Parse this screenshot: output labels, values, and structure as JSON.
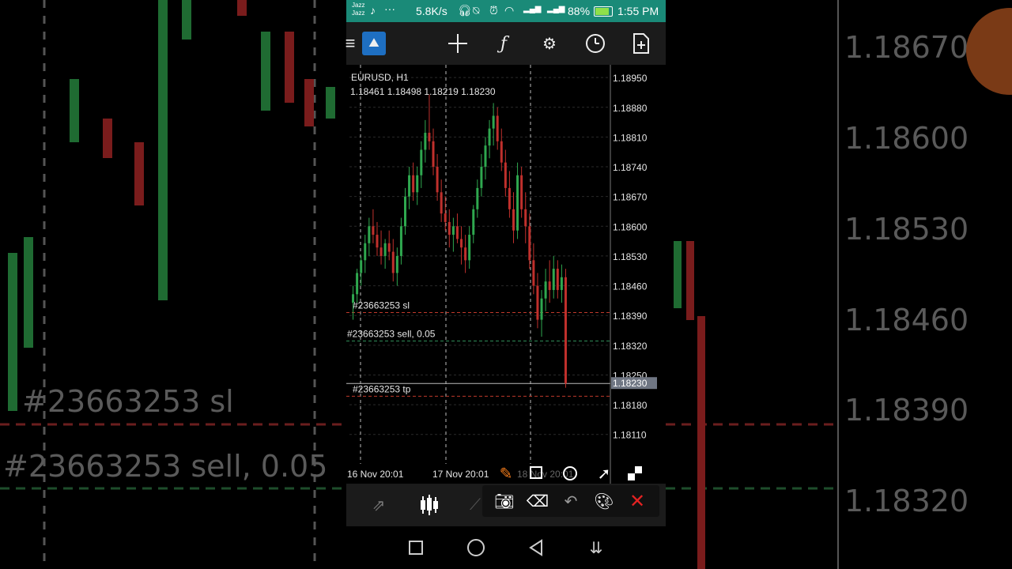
{
  "status_bar": {
    "carrier_line1": "Jazz",
    "carrier_line2": "Jazz",
    "extra": "···",
    "network_speed": "5.8K/s",
    "battery": "88%",
    "time": "1:55 PM"
  },
  "toolbar": {
    "menu_icon": "hamburger-menu-icon",
    "app_icon": "metatrader-logo-icon",
    "crosshair_icon": "crosshair-icon",
    "indicator_icon": "function-icon",
    "objects_icon": "objects-icon",
    "timeframe_icon": "clock-icon",
    "new_order_icon": "new-document-icon"
  },
  "chart_data": {
    "type": "candlestick",
    "title": "EURUSD, H1",
    "ohlc_readout": "1.18461 1.18498 1.18219 1.18230",
    "ylim": [
      1.1805,
      1.1898
    ],
    "y_ticks": [
      "1.18950",
      "1.18880",
      "1.18810",
      "1.18740",
      "1.18670",
      "1.18600",
      "1.18530",
      "1.18460",
      "1.18390",
      "1.18320",
      "1.18250",
      "1.18180",
      "1.18110"
    ],
    "x_ticks": [
      "16 Nov 20:01",
      "17 Nov 20:01",
      "18 Nov 20:01"
    ],
    "current_price": "1.18230",
    "levels": [
      {
        "label": "#23663253 sl",
        "price": 1.18397,
        "color": "#c0392b",
        "style": "dashed"
      },
      {
        "label": "#23663253 sell, 0.05",
        "price": 1.1833,
        "color": "#2e8b57",
        "style": "dashed"
      },
      {
        "label": "#23663253 tp",
        "price": 1.182,
        "color": "#c0392b",
        "style": "dashed"
      }
    ],
    "candles": [
      [
        1.1842,
        1.1846,
        1.1838,
        1.1844
      ],
      [
        1.1844,
        1.185,
        1.1842,
        1.1849
      ],
      [
        1.1849,
        1.1853,
        1.1846,
        1.1852
      ],
      [
        1.1852,
        1.1858,
        1.1849,
        1.1856
      ],
      [
        1.1856,
        1.1862,
        1.1853,
        1.186
      ],
      [
        1.186,
        1.1864,
        1.1856,
        1.1858
      ],
      [
        1.1858,
        1.1861,
        1.1853,
        1.1855
      ],
      [
        1.1855,
        1.1859,
        1.1851,
        1.1853
      ],
      [
        1.1853,
        1.1857,
        1.185,
        1.1856
      ],
      [
        1.1856,
        1.1859,
        1.1852,
        1.1854
      ],
      [
        1.1854,
        1.1857,
        1.1847,
        1.1849
      ],
      [
        1.1849,
        1.1855,
        1.1846,
        1.1853
      ],
      [
        1.1853,
        1.1862,
        1.1851,
        1.186
      ],
      [
        1.186,
        1.1869,
        1.1858,
        1.1867
      ],
      [
        1.1867,
        1.1874,
        1.1864,
        1.1872
      ],
      [
        1.1872,
        1.1875,
        1.1866,
        1.1868
      ],
      [
        1.1868,
        1.1874,
        1.1865,
        1.1872
      ],
      [
        1.1872,
        1.188,
        1.1869,
        1.1878
      ],
      [
        1.1878,
        1.1885,
        1.1875,
        1.1882
      ],
      [
        1.1882,
        1.1891,
        1.1878,
        1.188
      ],
      [
        1.188,
        1.1883,
        1.1872,
        1.1874
      ],
      [
        1.1874,
        1.1877,
        1.1866,
        1.1868
      ],
      [
        1.1868,
        1.1871,
        1.1861,
        1.1863
      ],
      [
        1.1863,
        1.1867,
        1.1859,
        1.1861
      ],
      [
        1.1861,
        1.1864,
        1.1855,
        1.1858
      ],
      [
        1.1858,
        1.1862,
        1.1854,
        1.186
      ],
      [
        1.186,
        1.1863,
        1.1856,
        1.1857
      ],
      [
        1.1857,
        1.186,
        1.1851,
        1.1855
      ],
      [
        1.1855,
        1.1858,
        1.1849,
        1.1852
      ],
      [
        1.1852,
        1.186,
        1.185,
        1.1858
      ],
      [
        1.1858,
        1.1865,
        1.1856,
        1.1864
      ],
      [
        1.1864,
        1.1871,
        1.1862,
        1.1869
      ],
      [
        1.1869,
        1.1877,
        1.1867,
        1.1874
      ],
      [
        1.1874,
        1.1881,
        1.1871,
        1.1879
      ],
      [
        1.1879,
        1.1885,
        1.1876,
        1.1883
      ],
      [
        1.1883,
        1.1889,
        1.1879,
        1.1886
      ],
      [
        1.1886,
        1.1888,
        1.1878,
        1.188
      ],
      [
        1.188,
        1.1883,
        1.1873,
        1.1875
      ],
      [
        1.1875,
        1.1878,
        1.1867,
        1.1869
      ],
      [
        1.1869,
        1.1873,
        1.1862,
        1.1864
      ],
      [
        1.1864,
        1.1868,
        1.1856,
        1.1859
      ],
      [
        1.1859,
        1.1875,
        1.1857,
        1.1872
      ],
      [
        1.1872,
        1.1874,
        1.1862,
        1.1864
      ],
      [
        1.1864,
        1.1868,
        1.1856,
        1.186
      ],
      [
        1.186,
        1.1863,
        1.185,
        1.1852
      ],
      [
        1.1852,
        1.1856,
        1.1844,
        1.1846
      ],
      [
        1.1846,
        1.1849,
        1.1836,
        1.1838
      ],
      [
        1.1838,
        1.1845,
        1.1834,
        1.1843
      ],
      [
        1.1843,
        1.185,
        1.184,
        1.1847
      ],
      [
        1.1847,
        1.1852,
        1.1842,
        1.1845
      ],
      [
        1.1845,
        1.1853,
        1.1843,
        1.185
      ],
      [
        1.185,
        1.1852,
        1.1843,
        1.1845
      ],
      [
        1.1845,
        1.1851,
        1.1842,
        1.1848
      ],
      [
        1.1848,
        1.185,
        1.1822,
        1.1823
      ]
    ]
  },
  "drawing_tools": {
    "pen_icon": "pen-icon",
    "rect_icon": "rectangle-icon",
    "circle_icon": "circle-icon",
    "arrow_icon": "arrow-icon",
    "mosaic_icon": "mosaic-icon",
    "camera_icon": "camera-icon",
    "eraser_icon": "eraser-icon",
    "undo_icon": "undo-icon",
    "palette_icon": "palette-icon",
    "close_icon": "close-icon"
  },
  "background": {
    "left_label_sl": "#23663253 sl",
    "left_label_sell": "#23663253 sell, 0.05",
    "right_ticks": [
      "1.18670",
      "1.18600",
      "1.18530",
      "1.18460",
      "1.18390",
      "1.18320"
    ]
  },
  "colors": {
    "status_bar": "#1a8a78",
    "bull": "#2fa84f",
    "bear": "#c0302c",
    "sl_tp": "#c0392b",
    "entry": "#2e8b57"
  }
}
